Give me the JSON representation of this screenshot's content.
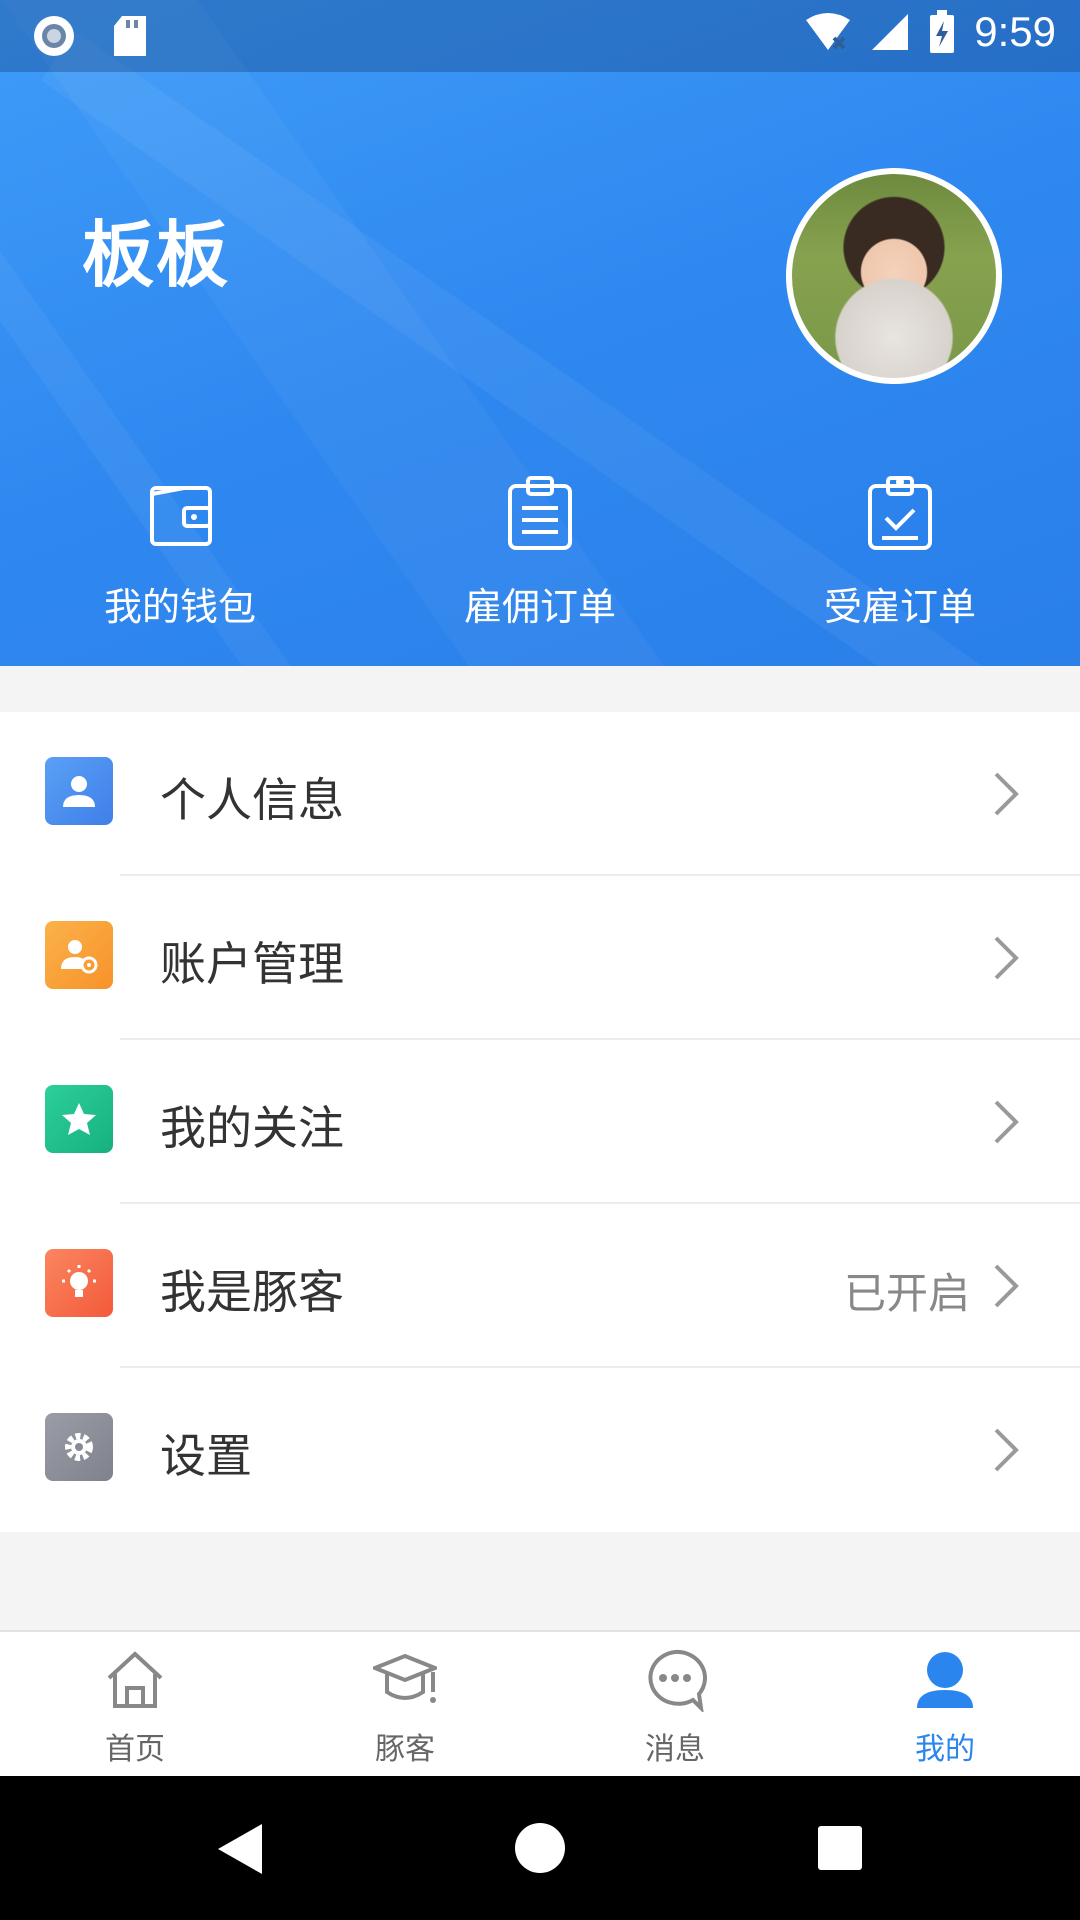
{
  "status_bar": {
    "time": "9:59",
    "icons": [
      "record-icon",
      "sd-card-icon",
      "wifi-off-icon",
      "signal-icon",
      "battery-charging-icon"
    ]
  },
  "profile": {
    "username": "板板",
    "avatar_description": "avatar"
  },
  "shortcuts": [
    {
      "label": "我的钱包",
      "icon": "wallet-icon"
    },
    {
      "label": "雇佣订单",
      "icon": "clipboard-list-icon"
    },
    {
      "label": "受雇订单",
      "icon": "clipboard-check-icon"
    }
  ],
  "menu": [
    {
      "label": "个人信息",
      "icon": "user-icon",
      "color": "#4a8ef0",
      "value": ""
    },
    {
      "label": "账户管理",
      "icon": "user-settings-icon",
      "color": "#f9a23a",
      "value": ""
    },
    {
      "label": "我的关注",
      "icon": "star-icon",
      "color": "#22bf8e",
      "value": ""
    },
    {
      "label": "我是豚客",
      "icon": "lightbulb-icon",
      "color": "#f7704d",
      "value": "已开启"
    },
    {
      "label": "设置",
      "icon": "gear-icon",
      "color": "#8f929c",
      "value": ""
    }
  ],
  "tabbar": [
    {
      "label": "首页",
      "icon": "home-icon",
      "active": false
    },
    {
      "label": "豚客",
      "icon": "graduation-cap-icon",
      "active": false
    },
    {
      "label": "消息",
      "icon": "chat-bubble-icon",
      "active": false
    },
    {
      "label": "我的",
      "icon": "person-icon",
      "active": true
    }
  ],
  "colors": {
    "header_blue": "#2f88f0",
    "active_tab": "#2a86ee"
  }
}
